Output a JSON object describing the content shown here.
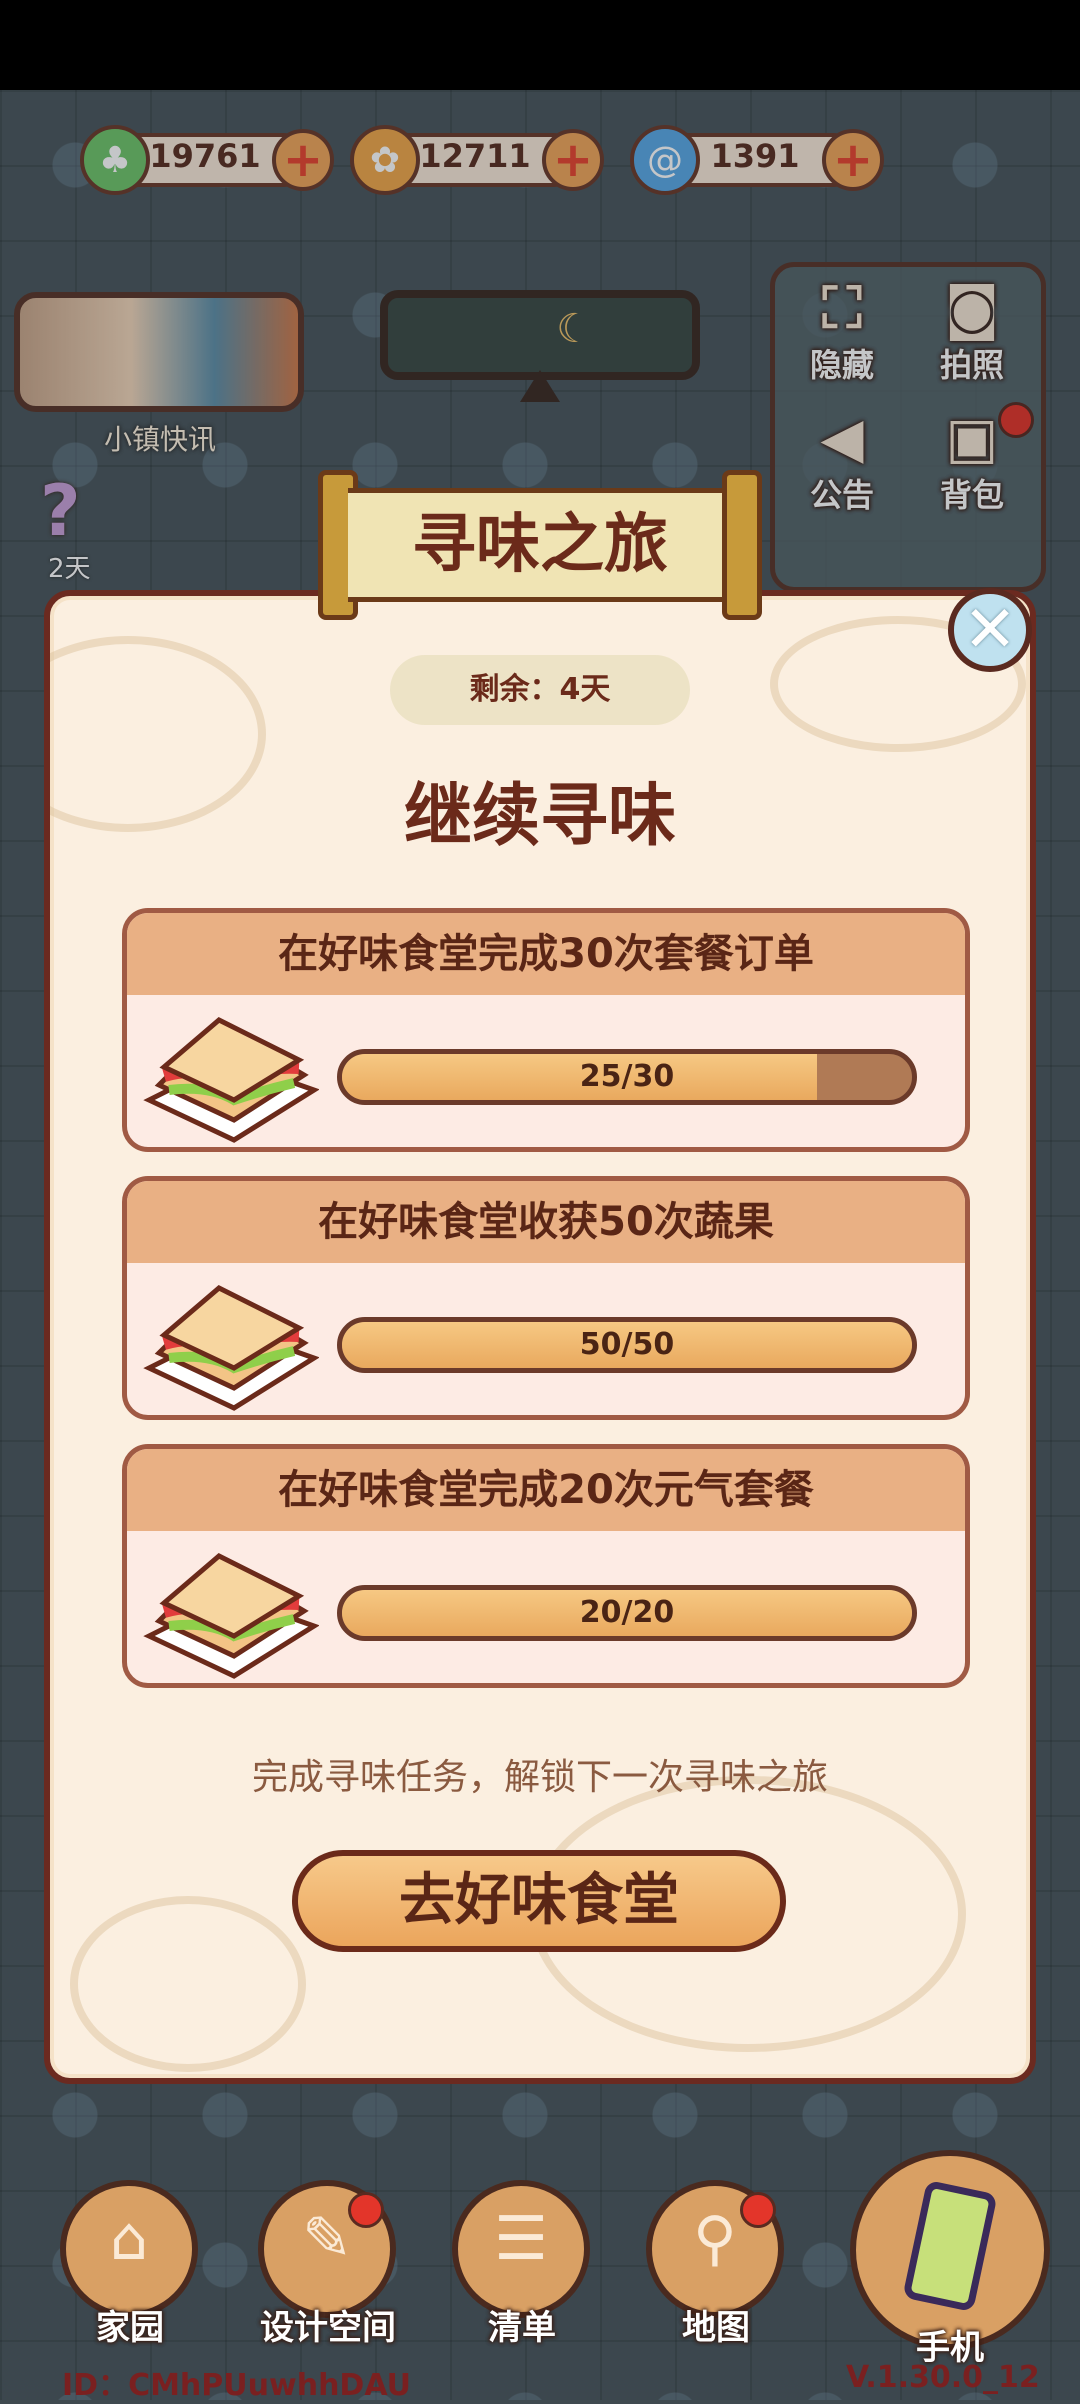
{
  "currencies": [
    {
      "value": "19761",
      "icon": "clover-icon",
      "color": "#6fc56a"
    },
    {
      "value": "12711",
      "icon": "coin-icon",
      "color": "#f0a74a"
    },
    {
      "value": "1391",
      "icon": "swirl-gem-icon",
      "color": "#5aa8e6"
    }
  ],
  "side": {
    "news_label": "小镇快讯",
    "day_label": "2天"
  },
  "right_panel": {
    "hide_label": "隐藏",
    "photo_label": "拍照",
    "notice_label": "公告",
    "backpack_label": "背包"
  },
  "modal": {
    "title": "寻味之旅",
    "remaining": "剩余：4天",
    "subtitle": "继续寻味",
    "tasks": [
      {
        "title": "在好味食堂完成30次套餐订单",
        "progress_text": "25/30",
        "progress": 0.8333
      },
      {
        "title": "在好味食堂收获50次蔬果",
        "progress_text": "50/50",
        "progress": 1.0
      },
      {
        "title": "在好味食堂完成20次元气套餐",
        "progress_text": "20/20",
        "progress": 1.0
      }
    ],
    "hint": "完成寻味任务，解锁下一次寻味之旅",
    "go_button": "去好味食堂",
    "close_glyph": "✕"
  },
  "bottom_nav": [
    {
      "label": "家园",
      "icon": "home-icon",
      "badge": false
    },
    {
      "label": "设计空间",
      "icon": "design-icon",
      "badge": true
    },
    {
      "label": "清单",
      "icon": "list-icon",
      "badge": false
    },
    {
      "label": "地图",
      "icon": "map-pin-icon",
      "badge": true
    },
    {
      "label": "手机",
      "icon": "phone-icon",
      "badge": false
    }
  ],
  "footer": {
    "id_text": "ID：CMhPUuwhhDAU",
    "version": "V.1.30.0_12"
  }
}
